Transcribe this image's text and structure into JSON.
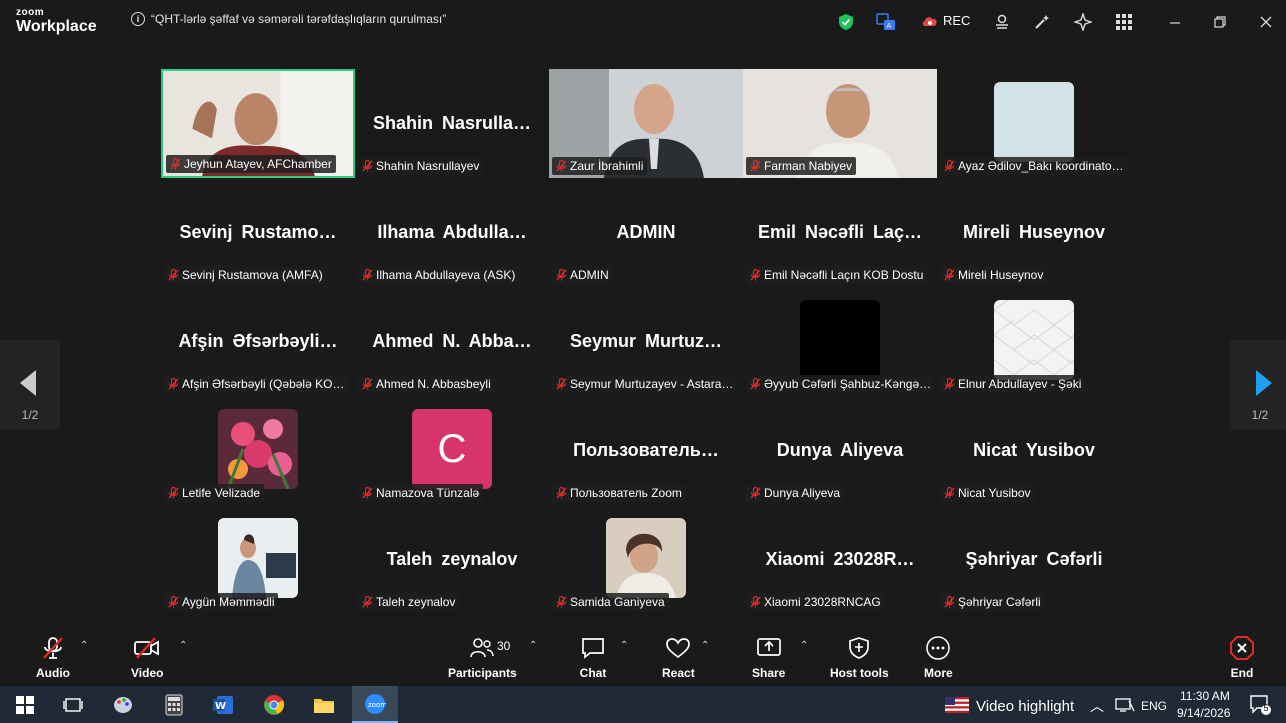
{
  "app": {
    "logo_top": "zoom",
    "logo_bottom": "Workplace"
  },
  "meeting": {
    "title": "“QHT-lərlə şəffaf və səmərəli tərəfdaşlıqların qurulması”"
  },
  "titlebar": {
    "rec_label": "REC"
  },
  "participants": [
    {
      "label": "Jeyhun Atayev, AFChamber",
      "big": "",
      "media": "video",
      "active": true
    },
    {
      "label": "Shahin Nasrullayev",
      "big": "Shahin Nasrulla…",
      "media": "none",
      "active": false
    },
    {
      "label": "Zaur İbrahimli",
      "big": "",
      "media": "video",
      "active": false
    },
    {
      "label": "Farman Nabiyev",
      "big": "",
      "media": "video",
      "active": false
    },
    {
      "label": "Ayaz Ədilov_Bakı koordinato…",
      "big": "",
      "media": "avatar",
      "active": false
    },
    {
      "label": "Sevinj Rustamova (AMFA)",
      "big": "Sevinj Rustamo…",
      "media": "none",
      "active": false
    },
    {
      "label": "Ilhama Abdullayeva (ASK)",
      "big": "Ilhama Abdulla…",
      "media": "none",
      "active": false
    },
    {
      "label": "ADMIN",
      "big": "ADMIN",
      "media": "none",
      "active": false
    },
    {
      "label": "Emil Nəcəfli Laçın KOB Dostu",
      "big": "Emil Nəcəfli Laç…",
      "media": "none",
      "active": false
    },
    {
      "label": "Mireli Huseynov",
      "big": "Mireli Huseynov",
      "media": "none",
      "active": false
    },
    {
      "label": "Afşin Əfsərbəyli (Qəbələ KO…",
      "big": "Afşin Əfsərbəyli…",
      "media": "none",
      "active": false
    },
    {
      "label": "Ahmed N. Abbasbeyli",
      "big": "Ahmed N. Abba…",
      "media": "none",
      "active": false
    },
    {
      "label": "Seymur Murtuzayev - Astara…",
      "big": "Seymur Murtuz…",
      "media": "none",
      "active": false
    },
    {
      "label": "Əyyub Cəfərli Şahbuz-Kəngə…",
      "big": "",
      "media": "avatar",
      "active": false
    },
    {
      "label": "Elnur Abdullayev - Şəki",
      "big": "",
      "media": "avatar",
      "active": false
    },
    {
      "label": "Letife Velizade",
      "big": "",
      "media": "avatar",
      "active": false
    },
    {
      "label": "Namazova Tünzalə",
      "big": "",
      "media": "letter",
      "letter": "C",
      "active": false
    },
    {
      "label": "Пользователь Zoom",
      "big": "Пользователь…",
      "media": "none",
      "active": false
    },
    {
      "label": "Dunya Aliyeva",
      "big": "Dunya Aliyeva",
      "media": "none",
      "active": false
    },
    {
      "label": "Nicat Yusibov",
      "big": "Nicat Yusibov",
      "media": "none",
      "active": false
    },
    {
      "label": "Aygün Məmmədli",
      "big": "",
      "media": "avatar",
      "active": false
    },
    {
      "label": "Taleh zeynalov",
      "big": "Taleh zeynalov",
      "media": "none",
      "active": false
    },
    {
      "label": "Samida Ganiyeva",
      "big": "",
      "media": "avatar",
      "active": false
    },
    {
      "label": "Xiaomi 23028RNCAG",
      "big": "Xiaomi 23028R…",
      "media": "none",
      "active": false
    },
    {
      "label": "Şəhriyar Cəfərli",
      "big": "Şəhriyar Cəfərli",
      "media": "none",
      "active": false
    }
  ],
  "pagination": {
    "left": "1/2",
    "right": "1/2"
  },
  "toolbar": {
    "audio": "Audio",
    "video": "Video",
    "participants": "Participants",
    "participants_count": "30",
    "chat": "Chat",
    "react": "React",
    "share": "Share",
    "host_tools": "Host tools",
    "more": "More",
    "end": "End"
  },
  "taskbar": {
    "video_highlight": "Video highlight",
    "lang": "ENG",
    "time": "11:30 AM",
    "date": "9/14/2026",
    "notifications": "5"
  },
  "colors": {
    "accent_green": "#26d07c",
    "mute_red": "#e02828",
    "blue_arrow": "#1ea0f0",
    "taskbar": "#1f2a36"
  }
}
